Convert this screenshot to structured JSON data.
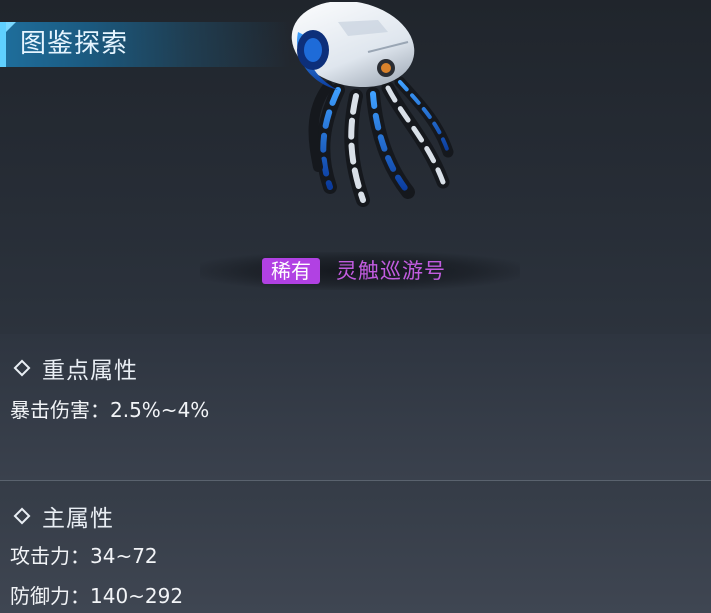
{
  "header": {
    "title": "图鉴探索"
  },
  "item": {
    "icon": "octopus-drone-icon",
    "rarity": "稀有",
    "name": "灵触巡游号",
    "rarity_color": "#b141e3",
    "name_color": "#c25ce0"
  },
  "key_attributes": {
    "title": "重点属性",
    "stats": [
      "暴击伤害：2.5%~4%"
    ]
  },
  "main_attributes": {
    "title": "主属性",
    "stats": [
      "攻击力：34~72",
      "防御力：140~292"
    ]
  }
}
